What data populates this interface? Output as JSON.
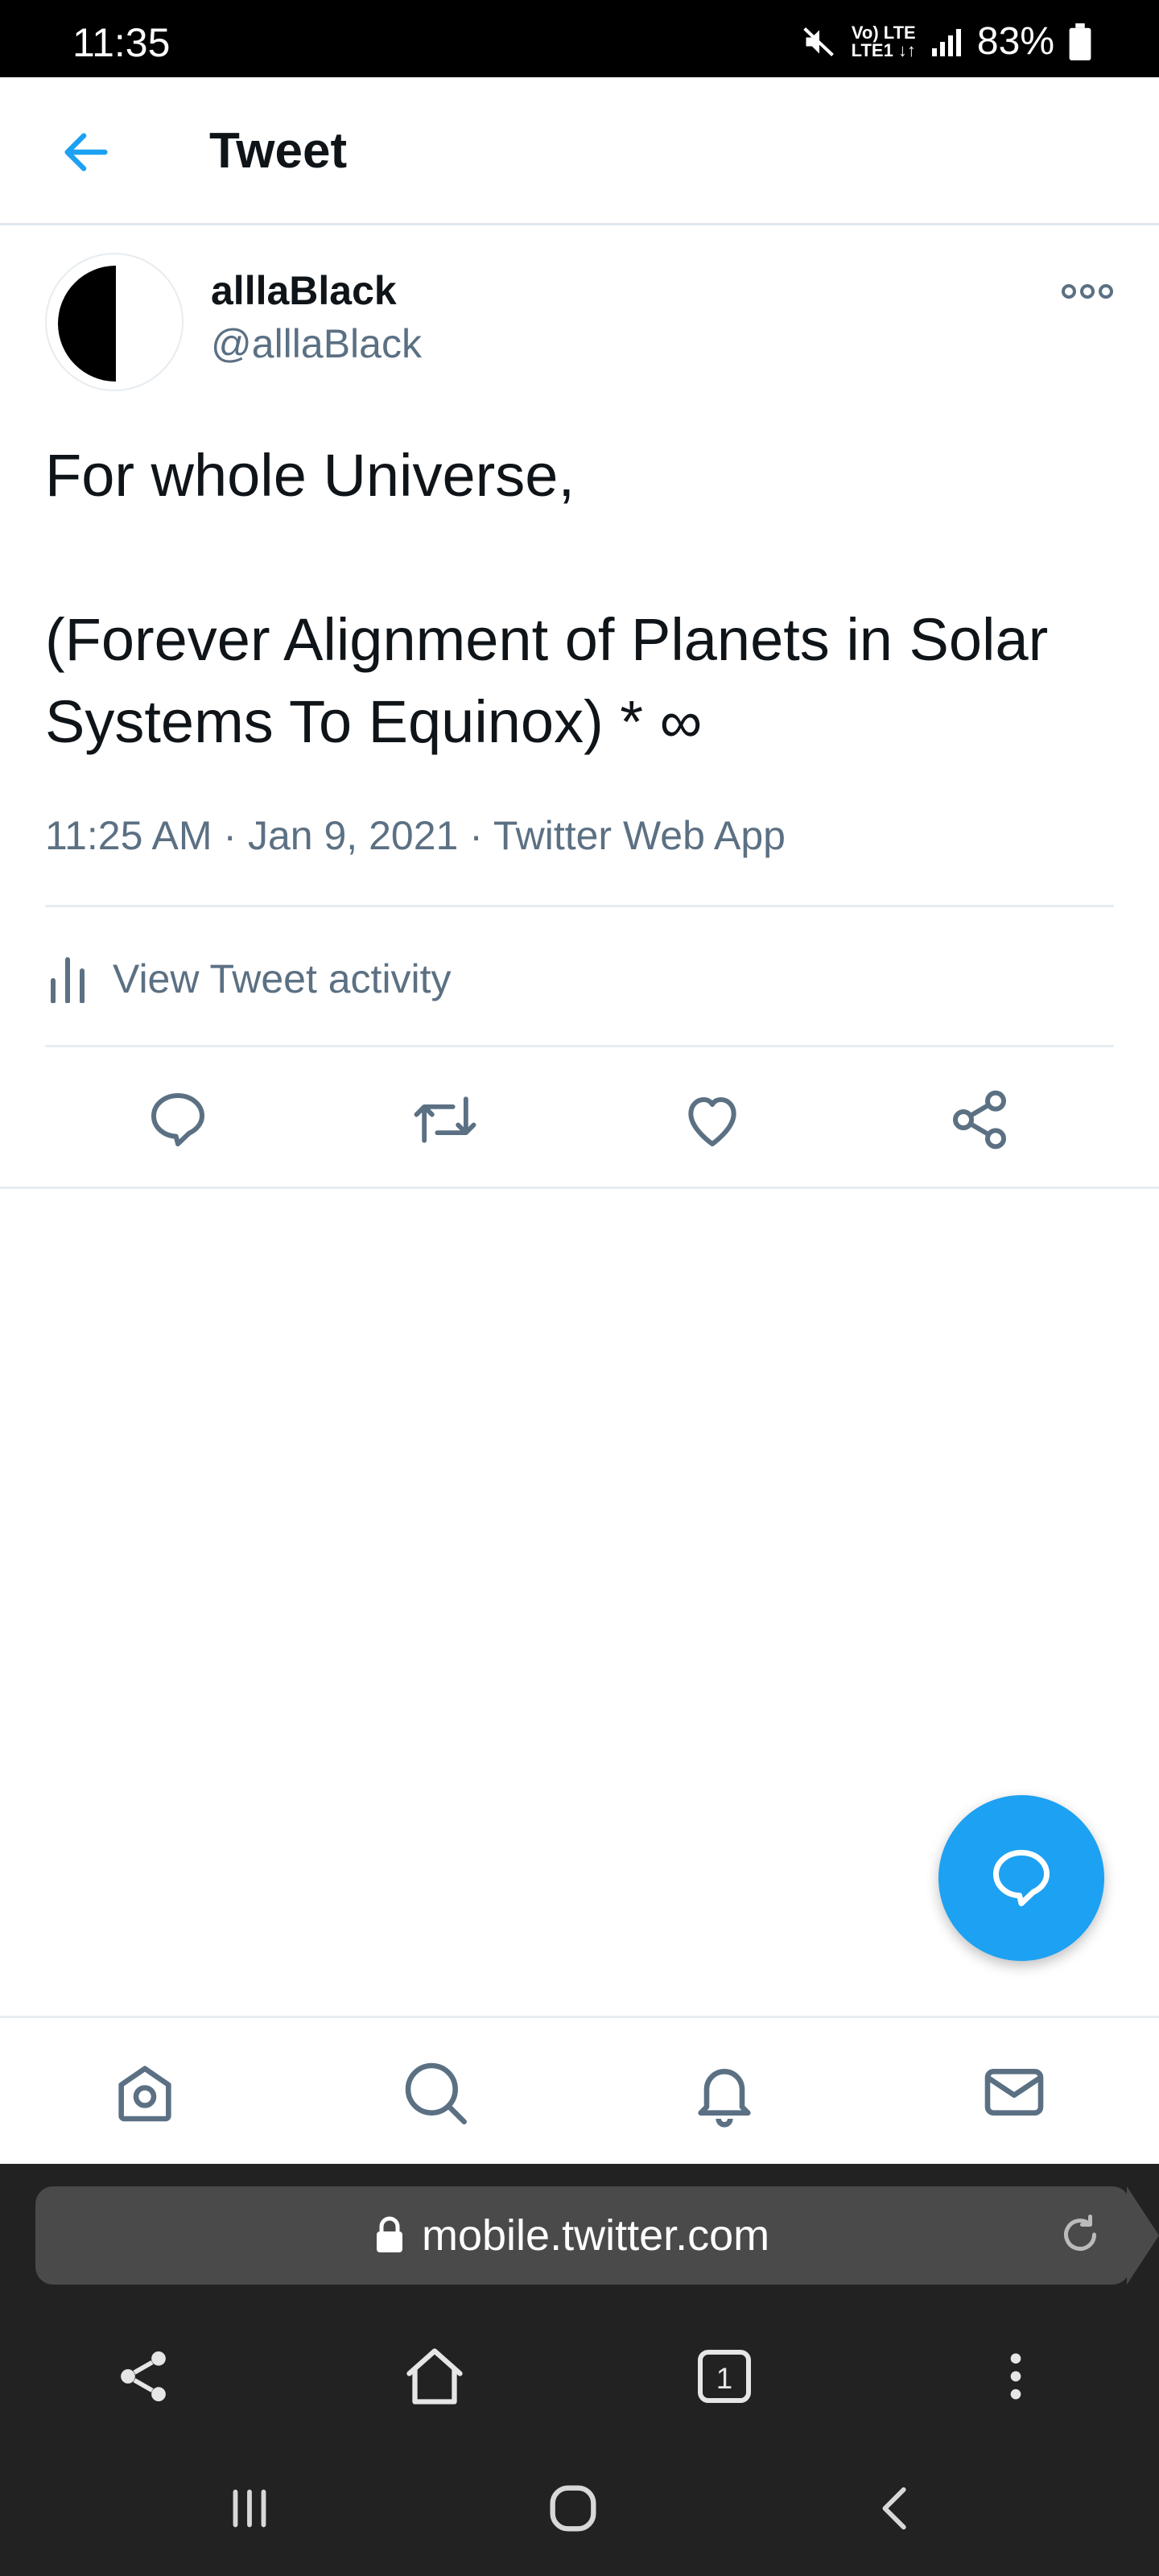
{
  "status_bar": {
    "time": "11:35",
    "network_top": "Vo) LTE",
    "network_bottom": "LTE1 ↓↑",
    "battery": "83%"
  },
  "header": {
    "title": "Tweet"
  },
  "tweet": {
    "display_name": "alllaBlack",
    "handle": "@alllaBlack",
    "text": "For whole Universe,\n\n(Forever Alignment of Planets in Solar Systems To Equinox) * ∞",
    "timestamp": "11:25 AM · Jan 9, 2021",
    "separator": " · ",
    "source": "Twitter Web App",
    "activity_label": "View Tweet activity"
  },
  "browser": {
    "url": "mobile.twitter.com",
    "tab_count": "1"
  },
  "colors": {
    "accent": "#1da1f2",
    "secondary_text": "#5b7083",
    "icon_gray": "#5b7083"
  },
  "icons": {
    "back": "back-arrow-icon",
    "more": "more-icon",
    "reply": "reply-icon",
    "retweet": "retweet-icon",
    "like": "like-icon",
    "share": "share-icon",
    "compose": "compose-reply-icon",
    "home": "home-icon",
    "search": "search-icon",
    "notifications": "notifications-icon",
    "messages": "messages-icon"
  }
}
